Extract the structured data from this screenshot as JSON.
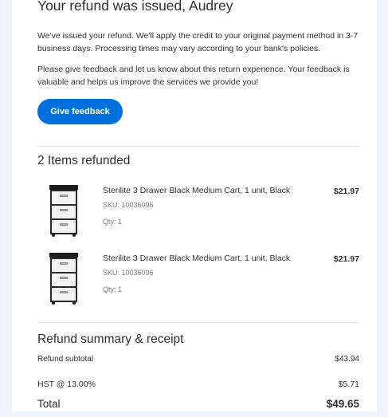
{
  "header": {
    "title": "Your refund was issued, Audrey",
    "message1": "We've issued your refund. We'll apply the credit to your original payment method in 3-7 business days. Processing times may vary according to your bank's policies.",
    "message2": "Please give feedback and let us know about this return experience. Your feedback is valuable and helps us improve the services we provide you!",
    "feedback_button": "Give feedback"
  },
  "items_section": {
    "title": "2 Items refunded",
    "items": [
      {
        "name": "Sterilite 3 Drawer Black Medium Cart, 1 unit, Black",
        "sku": "SKU: 10036096",
        "qty": "Qty: 1",
        "price": "$21.97"
      },
      {
        "name": "Sterilite 3 Drawer Black Medium Cart, 1 unit, Black",
        "sku": "SKU: 10036096",
        "qty": "Qty: 1",
        "price": "$21.97"
      }
    ]
  },
  "summary": {
    "title": "Refund summary & receipt",
    "subtotal_label": "Refund subtotal",
    "subtotal_value": "$43.94",
    "tax_label": "HST @ 13.00%",
    "tax_value": "$5.71",
    "total_label": "Total",
    "total_value": "$49.65"
  },
  "colors": {
    "accent": "#0071dc",
    "background": "#eef4fc",
    "text": "#2e2f32"
  }
}
